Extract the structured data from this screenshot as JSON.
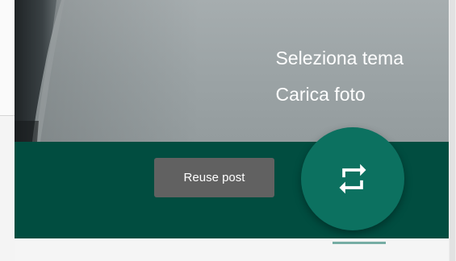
{
  "cover_menu": {
    "items": [
      {
        "label": "Seleziona tema"
      },
      {
        "label": "Carica foto"
      }
    ]
  },
  "tooltip": {
    "label": "Reuse post"
  },
  "fab": {
    "icon": "repeat-icon"
  },
  "colors": {
    "theme_bar": "#014d40",
    "fab": "#0c7160",
    "tooltip": "#616161",
    "cover_photo": "#9ba3a5"
  }
}
